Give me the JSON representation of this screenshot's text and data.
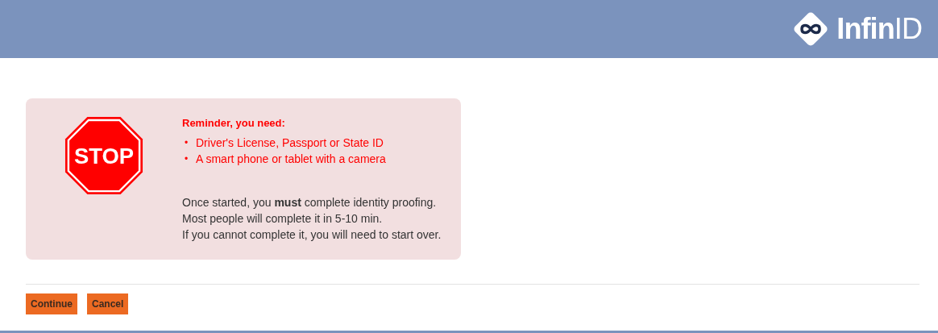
{
  "header": {
    "logo": {
      "bold": "Infin",
      "light": "ID"
    }
  },
  "notice": {
    "sign": "STOP",
    "heading": "Reminder, you need:",
    "items": [
      {
        "bullet": "•",
        "text": "Driver's License, Passport or State ID"
      },
      {
        "bullet": "•",
        "text": "A smart phone or tablet with a camera"
      }
    ],
    "lines": [
      "Once started, you **must** complete identity proofing.",
      "Most people will complete it in 5-10 min.",
      "If you cannot complete it, you will need to start over."
    ]
  },
  "buttons": [
    "Continue",
    "Cancel"
  ]
}
